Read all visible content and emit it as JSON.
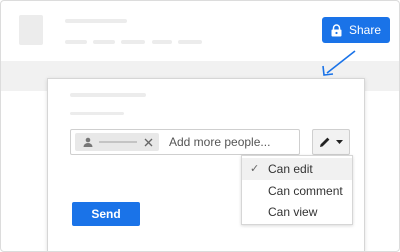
{
  "header": {
    "share_label": "Share",
    "icons": {
      "share_lock": "lock-icon",
      "pointer": "arrow-pointer-icon"
    }
  },
  "share_dialog": {
    "people_field": {
      "placeholder": "Add more people..."
    },
    "chip_icons": {
      "avatar": "person-icon",
      "remove": "close-icon"
    },
    "permission_button_icon": "pencil-icon",
    "permission_menu": {
      "selected": "Can edit",
      "options": [
        {
          "label": "Can edit",
          "checked": true
        },
        {
          "label": "Can comment",
          "checked": false
        },
        {
          "label": "Can view",
          "checked": false
        }
      ]
    },
    "send_label": "Send"
  },
  "colors": {
    "accent": "#1a73e8",
    "placeholder_gray": "#ececec"
  }
}
